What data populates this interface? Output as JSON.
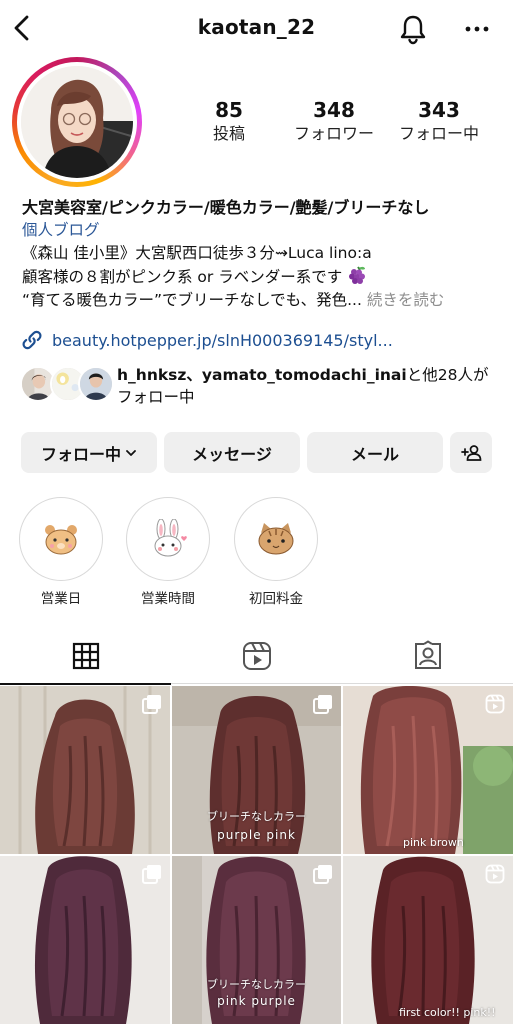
{
  "header": {
    "username": "kaotan_22"
  },
  "profile": {
    "stats": [
      {
        "value": "85",
        "label": "投稿"
      },
      {
        "value": "348",
        "label": "フォロワー"
      },
      {
        "value": "343",
        "label": "フォロー中"
      }
    ],
    "name": "大宮美容室/ピンクカラー/暖色カラー/艶髪/ブリーチなし",
    "category": "個人ブログ",
    "bio_lines": [
      "《森山 佳小里》大宮駅西口徒歩３分⇝Luca lino:a",
      "顧客様の８割がピンク系 or ラベンダー系です",
      "“育てる暖色カラー”でブリーチなしでも、発色..."
    ],
    "more_label": "続きを読む",
    "link": "beauty.hotpepper.jp/slnH000369145/styl...",
    "followed_by": {
      "names": "h_hnksz、yamato_tomodachi_inai",
      "suffix": "と他28人がフォロー中"
    }
  },
  "actions": {
    "following_label": "フォロー中",
    "message_label": "メッセージ",
    "email_label": "メール"
  },
  "highlights": [
    {
      "label": "営業日",
      "icon": "bear-icon"
    },
    {
      "label": "営業時間",
      "icon": "rabbit-icon"
    },
    {
      "label": "初回料金",
      "icon": "cat-icon"
    }
  ],
  "tabs": [
    {
      "name": "grid-icon",
      "active": true
    },
    {
      "name": "reels-icon",
      "active": false
    },
    {
      "name": "tagged-icon",
      "active": false
    }
  ],
  "grid_posts": [
    {
      "type": "carousel",
      "overlay": ""
    },
    {
      "type": "carousel",
      "overlay_top": "ブリーチなしカラー",
      "overlay_bottom": "purple pink"
    },
    {
      "type": "reel",
      "overlay": "pink brown"
    },
    {
      "type": "carousel",
      "overlay": ""
    },
    {
      "type": "carousel",
      "overlay_top": "ブリーチなしカラー",
      "overlay_bottom": "pink purple"
    },
    {
      "type": "reel",
      "overlay": "first color!!  pink!!"
    }
  ],
  "colors": {
    "link": "#1d4f91",
    "button_bg": "#efefef",
    "muted": "#8e8e8e"
  }
}
